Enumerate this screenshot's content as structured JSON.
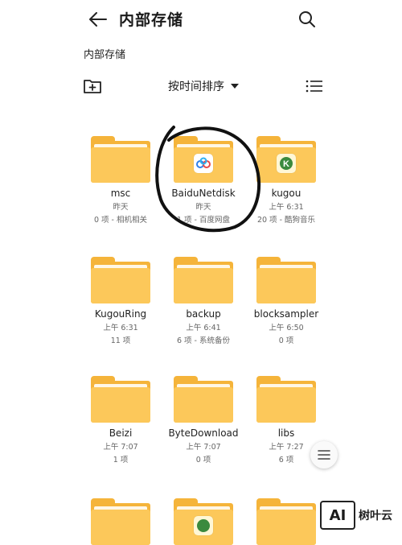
{
  "header": {
    "title": "内部存储",
    "back_icon": "arrow-left-icon",
    "search_icon": "search-icon"
  },
  "breadcrumb": {
    "path": "内部存储"
  },
  "toolbar": {
    "new_folder_icon": "new-folder-icon",
    "sort_label": "按时间排序",
    "sort_icon": "caret-down-icon",
    "view_icon": "list-view-icon"
  },
  "folders": [
    {
      "name": "msc",
      "date": "昨天",
      "meta": "0 项 - 相机相关",
      "badge": ""
    },
    {
      "name": "BaiduNetdisk",
      "date": "昨天",
      "meta": "1 项 - 百度网盘",
      "badge": "baidu-netdisk-icon"
    },
    {
      "name": "kugou",
      "date": "上午 6:31",
      "meta": "20 项 - 酷狗音乐",
      "badge": "kugou-icon"
    },
    {
      "name": "KugouRing",
      "date": "上午 6:31",
      "meta": "11 项",
      "badge": ""
    },
    {
      "name": "backup",
      "date": "上午 6:41",
      "meta": "6 项 - 系统备份",
      "badge": ""
    },
    {
      "name": "blocksampler",
      "date": "上午 6:50",
      "meta": "0 项",
      "badge": ""
    },
    {
      "name": "Beizi",
      "date": "上午 7:07",
      "meta": "1 项",
      "badge": ""
    },
    {
      "name": "ByteDownload",
      "date": "上午 7:07",
      "meta": "0 项",
      "badge": ""
    },
    {
      "name": "libs",
      "date": "上午 7:27",
      "meta": "6 项",
      "badge": ""
    },
    {
      "name": "",
      "date": "",
      "meta": "",
      "badge": ""
    },
    {
      "name": "",
      "date": "",
      "meta": "",
      "badge": "kugou-icon"
    },
    {
      "name": "",
      "date": "",
      "meta": "",
      "badge": ""
    }
  ],
  "scroll_handle": {
    "icon": "menu-lines-icon"
  },
  "watermark": {
    "logo_text": "AI",
    "text": "树叶云"
  },
  "colors": {
    "folder_front": "#fcc85a",
    "folder_back": "#f5b43a",
    "annotation": "#111111"
  }
}
